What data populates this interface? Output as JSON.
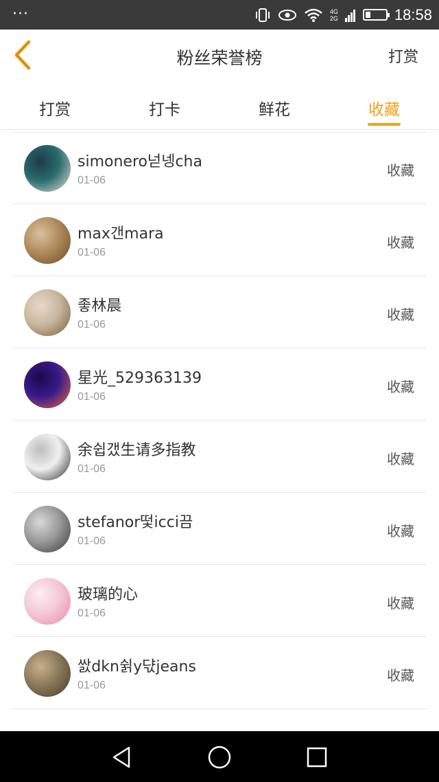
{
  "status_bar": {
    "dots": "···",
    "network": "4G\n2G",
    "time": "18:58",
    "battery_level": 0.25
  },
  "header": {
    "title": "粉丝荣誉榜",
    "action": "打赏"
  },
  "tabs": [
    {
      "label": "打赏",
      "active": false
    },
    {
      "label": "打卡",
      "active": false
    },
    {
      "label": "鲜花",
      "active": false
    },
    {
      "label": "收藏",
      "active": true
    }
  ],
  "list": [
    {
      "name": "simonero넏넹cha",
      "date": "01-06",
      "action": "收藏",
      "avatar_colors": [
        "#2a6b6e",
        "#e8e0d8",
        "#1b3b4a"
      ]
    },
    {
      "name": "max갠mara",
      "date": "01-06",
      "action": "收藏",
      "avatar_colors": [
        "#b08a5a",
        "#6b4a2a",
        "#d7c2a0"
      ]
    },
    {
      "name": "좋林晨",
      "date": "01-06",
      "action": "收藏",
      "avatar_colors": [
        "#c8b8a0",
        "#7a5a3a",
        "#e8d8c8"
      ]
    },
    {
      "name": "星光_529363139",
      "date": "01-06",
      "action": "收藏",
      "avatar_colors": [
        "#3a1a8a",
        "#e86a3a",
        "#1a0a4a"
      ]
    },
    {
      "name": "余쉽갰生请多指教",
      "date": "01-06",
      "action": "收藏",
      "avatar_colors": [
        "#f0f0f0",
        "#2a2a2a",
        "#bdbdbd"
      ]
    },
    {
      "name": "stefanor떷icci끔",
      "date": "01-06",
      "action": "收藏",
      "avatar_colors": [
        "#9a9a9a",
        "#3a3a3a",
        "#d8d8d8"
      ]
    },
    {
      "name": "玻璃的心",
      "date": "01-06",
      "action": "收藏",
      "avatar_colors": [
        "#f4c8d8",
        "#e88aa8",
        "#fbeef3"
      ]
    },
    {
      "name": "쌄dkn쉵y댟jeans",
      "date": "01-06",
      "action": "收藏",
      "avatar_colors": [
        "#8a7a5a",
        "#4a3a2a",
        "#c8b08a"
      ]
    }
  ],
  "icons": {
    "back": "chevron-left-icon",
    "nav": [
      "back-triangle-icon",
      "home-circle-icon",
      "recents-square-icon"
    ]
  },
  "colors": {
    "accent": "#f0a21c",
    "status_bar": "#3a3a3a"
  }
}
